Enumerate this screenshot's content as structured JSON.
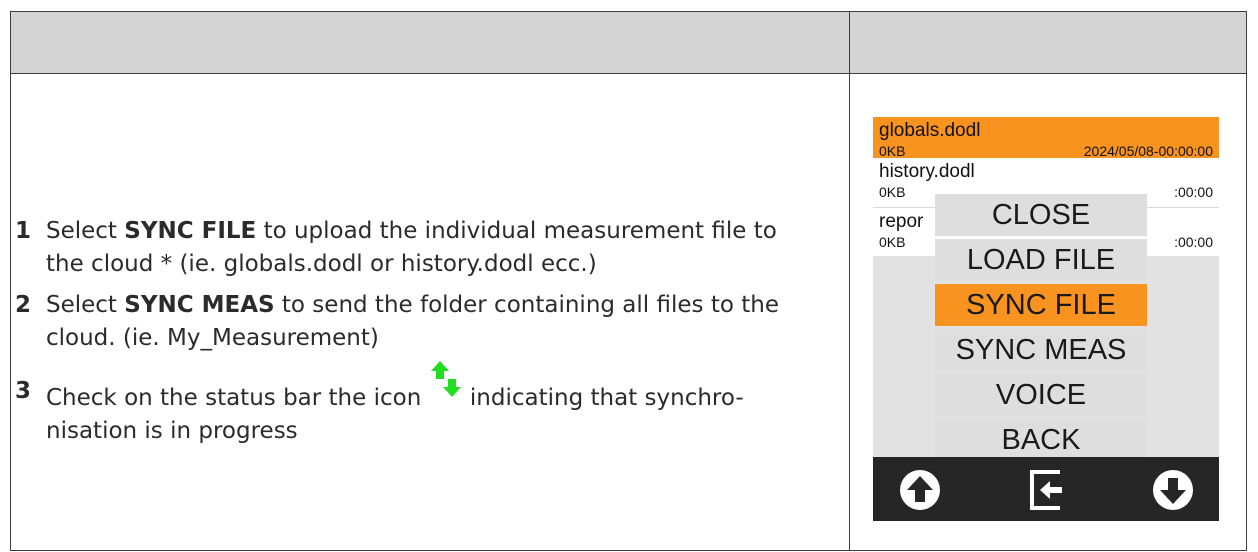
{
  "steps": [
    {
      "num": "1",
      "pre": "Select ",
      "bold": "SYNC FILE",
      "post": " to upload the individual measurement file to the cloud * (ie. globals.dodl or history.dodl ecc.)"
    },
    {
      "num": "2",
      "pre": "Select ",
      "bold": "SYNC MEAS",
      "post": " to send the folder containing all files to the cloud. (ie. My_Measurement)"
    },
    {
      "num": "3",
      "pre": "Check on the status bar the icon",
      "post": "indicating that synchro-nisation is in progress",
      "icon": "sync-arrows-icon"
    }
  ],
  "device": {
    "files": [
      {
        "name": "globals.dodl",
        "size": "0KB",
        "date": "2024/05/08-00:00:00",
        "selected": true
      },
      {
        "name": "history.dodl",
        "size": "0KB",
        "date": ":00:00"
      },
      {
        "name": "repor",
        "size": "0KB",
        "date": ":00:00"
      }
    ],
    "menu": [
      "CLOSE",
      "LOAD FILE",
      "SYNC FILE",
      "SYNC MEAS",
      "VOICE",
      "BACK"
    ],
    "active_menu": "SYNC FILE",
    "bottom_icons": [
      "arrow-up-circle-icon",
      "exit-door-icon",
      "arrow-down-circle-icon"
    ]
  },
  "colors": {
    "accent": "#f7931e",
    "header": "#d4d4d4",
    "sync_green": "#22dd22",
    "bar": "#262626"
  }
}
